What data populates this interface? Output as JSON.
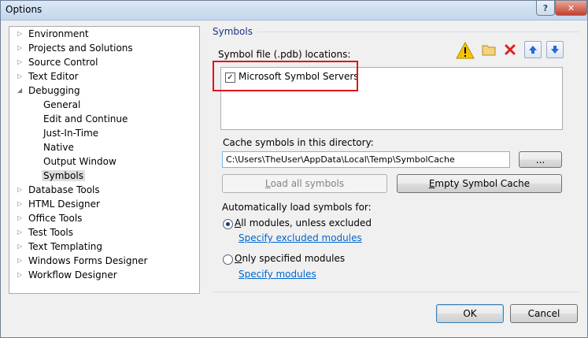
{
  "window": {
    "title": "Options",
    "help_label": "?",
    "close_label": "✕"
  },
  "tree": {
    "items": [
      {
        "label": "Environment",
        "expander": "▷",
        "selected": false
      },
      {
        "label": "Projects and Solutions",
        "expander": "▷",
        "selected": false
      },
      {
        "label": "Source Control",
        "expander": "▷",
        "selected": false
      },
      {
        "label": "Text Editor",
        "expander": "▷",
        "selected": false
      },
      {
        "label": "Debugging",
        "expander": "◢",
        "selected": false
      },
      {
        "label": "General",
        "expander": "",
        "selected": false
      },
      {
        "label": "Edit and Continue",
        "expander": "",
        "selected": false
      },
      {
        "label": "Just-In-Time",
        "expander": "",
        "selected": false
      },
      {
        "label": "Native",
        "expander": "",
        "selected": false
      },
      {
        "label": "Output Window",
        "expander": "",
        "selected": false
      },
      {
        "label": "Symbols",
        "expander": "",
        "selected": true
      },
      {
        "label": "Database Tools",
        "expander": "▷",
        "selected": false
      },
      {
        "label": "HTML Designer",
        "expander": "▷",
        "selected": false
      },
      {
        "label": "Office Tools",
        "expander": "▷",
        "selected": false
      },
      {
        "label": "Test Tools",
        "expander": "▷",
        "selected": false
      },
      {
        "label": "Text Templating",
        "expander": "▷",
        "selected": false
      },
      {
        "label": "Windows Forms Designer",
        "expander": "▷",
        "selected": false
      },
      {
        "label": "Workflow Designer",
        "expander": "▷",
        "selected": false
      }
    ]
  },
  "symbols": {
    "group_title": "Symbols",
    "locations_label": "Symbol file (.pdb) locations:",
    "toolbar_icons": [
      "warning-icon",
      "folder-icon",
      "delete-icon",
      "move-up-icon",
      "move-down-icon"
    ],
    "locations": [
      {
        "label": "Microsoft Symbol Servers",
        "checked": true
      }
    ],
    "cache_label": "Cache symbols in this directory:",
    "cache_path": "C:\\Users\\TheUser\\AppData\\Local\\Temp\\SymbolCache",
    "browse_label": "...",
    "load_all": {
      "prefix": "",
      "accel": "L",
      "rest": "oad all symbols"
    },
    "empty_cache": {
      "prefix": "",
      "accel": "E",
      "rest": "mpty Symbol Cache"
    },
    "auto_load_label": "Automatically load symbols for:",
    "option_all": {
      "prefix": "",
      "accel": "A",
      "rest": "ll modules, unless excluded",
      "selected": true
    },
    "link_excluded": "Specify excluded modules",
    "option_only": {
      "prefix": "",
      "accel": "O",
      "rest": "nly specified modules",
      "selected": false
    },
    "link_modules": "Specify modules"
  },
  "footer": {
    "ok_label": "OK",
    "cancel_label": "Cancel"
  },
  "colors": {
    "highlight_box": "#e0141e",
    "link": "#0066cc",
    "group_title": "#1e3287"
  }
}
